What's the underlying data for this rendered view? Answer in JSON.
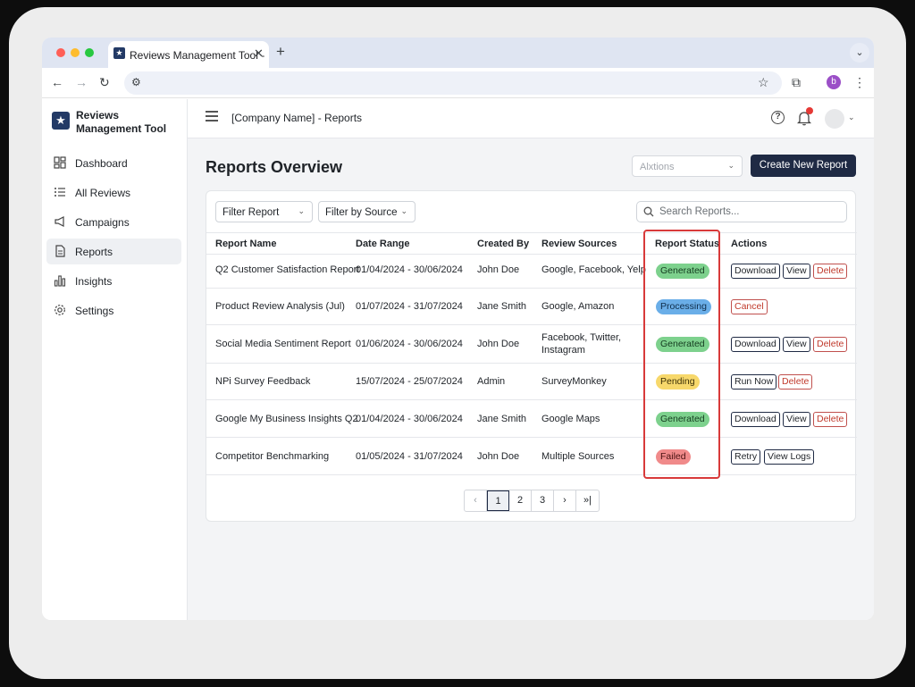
{
  "browser": {
    "tab_title": "Reviews Management Tool -",
    "profile_initial": "b",
    "icons": [
      "back-icon",
      "forward-icon",
      "reload-icon",
      "site-settings-icon",
      "bookmark-star-icon",
      "extensions-icon",
      "kebab-menu-icon"
    ]
  },
  "sidebar": {
    "brand": "Reviews Management Tool",
    "items": [
      {
        "label": "Dashboard",
        "icon": "dashboard-icon"
      },
      {
        "label": "All Reviews",
        "icon": "list-icon"
      },
      {
        "label": "Campaigns",
        "icon": "megaphone-icon"
      },
      {
        "label": "Reports",
        "icon": "document-icon",
        "active": true
      },
      {
        "label": "Insights",
        "icon": "bar-chart-icon"
      },
      {
        "label": "Settings",
        "icon": "gear-icon"
      }
    ]
  },
  "header": {
    "breadcrumb": "[Company Name]  - Reports"
  },
  "main": {
    "title": "Reports Overview",
    "actions_select": "Alxtions",
    "create_button": "Create New Report",
    "filters": {
      "filter_report": "Filter Report",
      "filter_source": "Filter by Source"
    },
    "search_placeholder": "Search Reports...",
    "columns": [
      "Report Name",
      "Date Range",
      "Created By",
      "Review Sources",
      "Report Status",
      "Actions"
    ],
    "rows": [
      {
        "name": "Q2 Customer Satisfaction Report",
        "date": "01/04/2024 - 30/06/2024",
        "by": "John Doe",
        "sources": "Google, Facebook, Yelp",
        "status": "Generated",
        "actions": [
          "Download",
          "View",
          "Delete"
        ]
      },
      {
        "name": "Product Review Analysis (Jul)",
        "date": "01/07/2024 - 31/07/2024",
        "by": "Jane Smith",
        "sources": "Google, Amazon",
        "status": "Processing",
        "actions": [
          "Cancel"
        ]
      },
      {
        "name": "Social Media Sentiment Report",
        "date": "01/06/2024 - 30/06/2024",
        "by": "John Doe",
        "sources": "Facebook, Twitter, Instagram",
        "status": "Generated",
        "actions": [
          "Download",
          "View",
          "Delete"
        ]
      },
      {
        "name": "NPi Survey Feedback",
        "date": "15/07/2024 - 25/07/2024",
        "by": "Admin",
        "sources": "SurveyMonkey",
        "status": "Pending",
        "actions": [
          "Run Now",
          "Delete"
        ]
      },
      {
        "name": "Google My Business Insights Q2",
        "date": "01/04/2024 - 30/06/2024",
        "by": "Jane Smith",
        "sources": "Google Maps",
        "status": "Generated",
        "actions": [
          "Download",
          "View",
          "Delete"
        ]
      },
      {
        "name": "Competitor Benchmarking",
        "date": "01/05/2024 - 31/07/2024",
        "by": "John Doe",
        "sources": "Multiple Sources",
        "status": "Failed",
        "actions": [
          "Retry",
          "View Logs"
        ]
      }
    ],
    "pagination": [
      "‹",
      "1",
      "2",
      "3",
      "›",
      "»|"
    ],
    "active_page": "1"
  },
  "colors": {
    "primary": "#1f2a44",
    "generated": "#7dd18d",
    "processing": "#6aaee8",
    "pending": "#f7d86b",
    "failed": "#f08a8a",
    "highlight": "#d83a3a"
  }
}
